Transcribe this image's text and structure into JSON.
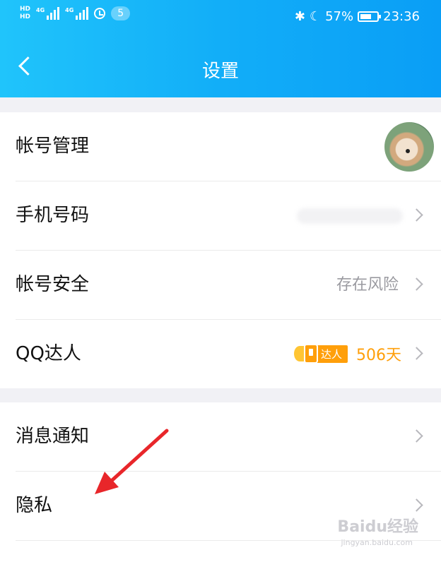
{
  "status_bar": {
    "hd1": "HD",
    "hd2": "HD",
    "net1": "4G",
    "net2": "4G",
    "notif_count": "5",
    "battery": "57%",
    "time": "23:36"
  },
  "header": {
    "title": "设置"
  },
  "group1": {
    "account": "帐号管理",
    "phone": "手机号码",
    "security": "帐号安全",
    "security_value": "存在风险",
    "qq_expert": "QQ达人",
    "qq_tag": "达人",
    "qq_days": "506天"
  },
  "group2": {
    "notify": "消息通知",
    "privacy": "隐私"
  },
  "watermark": {
    "main": "Baidu经验",
    "sub": "jingyan.baidu.com"
  },
  "colors": {
    "accent": "#12aef8",
    "orange": "#ff9f0a",
    "arrow": "#e8262a"
  }
}
